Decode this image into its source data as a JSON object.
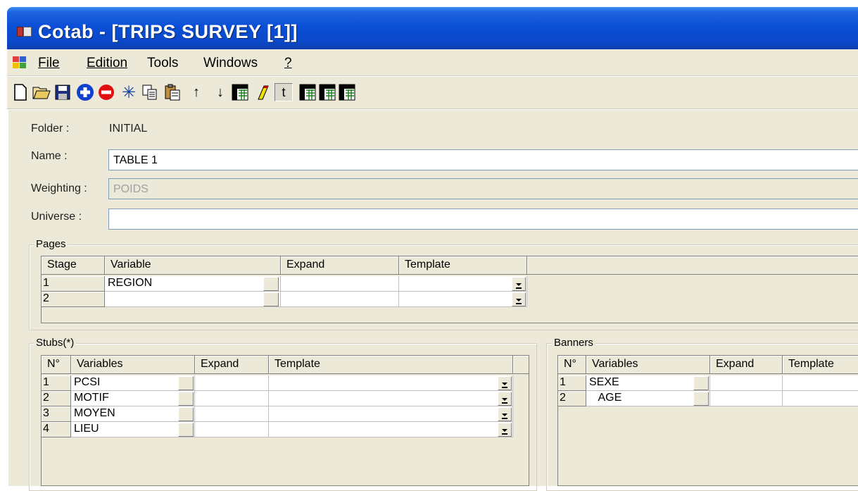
{
  "window": {
    "title": "Cotab - [TRIPS SURVEY [1]]"
  },
  "menu": {
    "items": [
      "File",
      "Edition",
      "Tools",
      "Windows",
      "?"
    ]
  },
  "toolbar": {
    "icons": [
      "new-icon",
      "open-folder-icon",
      "save-icon",
      "add-circle-icon",
      "remove-circle-icon",
      "asterisk-icon",
      "copy-icon",
      "paste-icon",
      "arrow-up-icon",
      "arrow-down-icon",
      "table-icon",
      "pen-icon",
      "t-icon",
      "table-icon-2",
      "table-icon-3",
      "table-icon-4"
    ],
    "arrow_up": "↑",
    "arrow_down": "↓",
    "t_label": "t"
  },
  "form": {
    "folder_label": "Folder :",
    "folder_value": "INITIAL",
    "name_label": "Name :",
    "name_value": "TABLE 1",
    "weighting_label": "Weighting :",
    "weighting_value": "POIDS",
    "universe_label": "Universe :",
    "universe_value": ""
  },
  "pages": {
    "title": "Pages",
    "columns": [
      "Stage",
      "Variable",
      "Expand",
      "Template"
    ],
    "rows": [
      {
        "n": "1",
        "variable": "REGION"
      },
      {
        "n": "2",
        "variable": ""
      }
    ]
  },
  "stubs": {
    "title": "Stubs(*)",
    "columns": [
      "N°",
      "Variables",
      "Expand",
      "Template"
    ],
    "rows": [
      {
        "n": "1",
        "variable": "PCSI"
      },
      {
        "n": "2",
        "variable": "MOTIF"
      },
      {
        "n": "3",
        "variable": "MOYEN"
      },
      {
        "n": "4",
        "variable": "LIEU"
      }
    ]
  },
  "banners": {
    "title": "Banners",
    "columns": [
      "N°",
      "Variables",
      "Expand",
      "Template"
    ],
    "rows": [
      {
        "n": "1",
        "variable": "SEXE"
      },
      {
        "n": "2",
        "variable": "   AGE"
      }
    ]
  }
}
